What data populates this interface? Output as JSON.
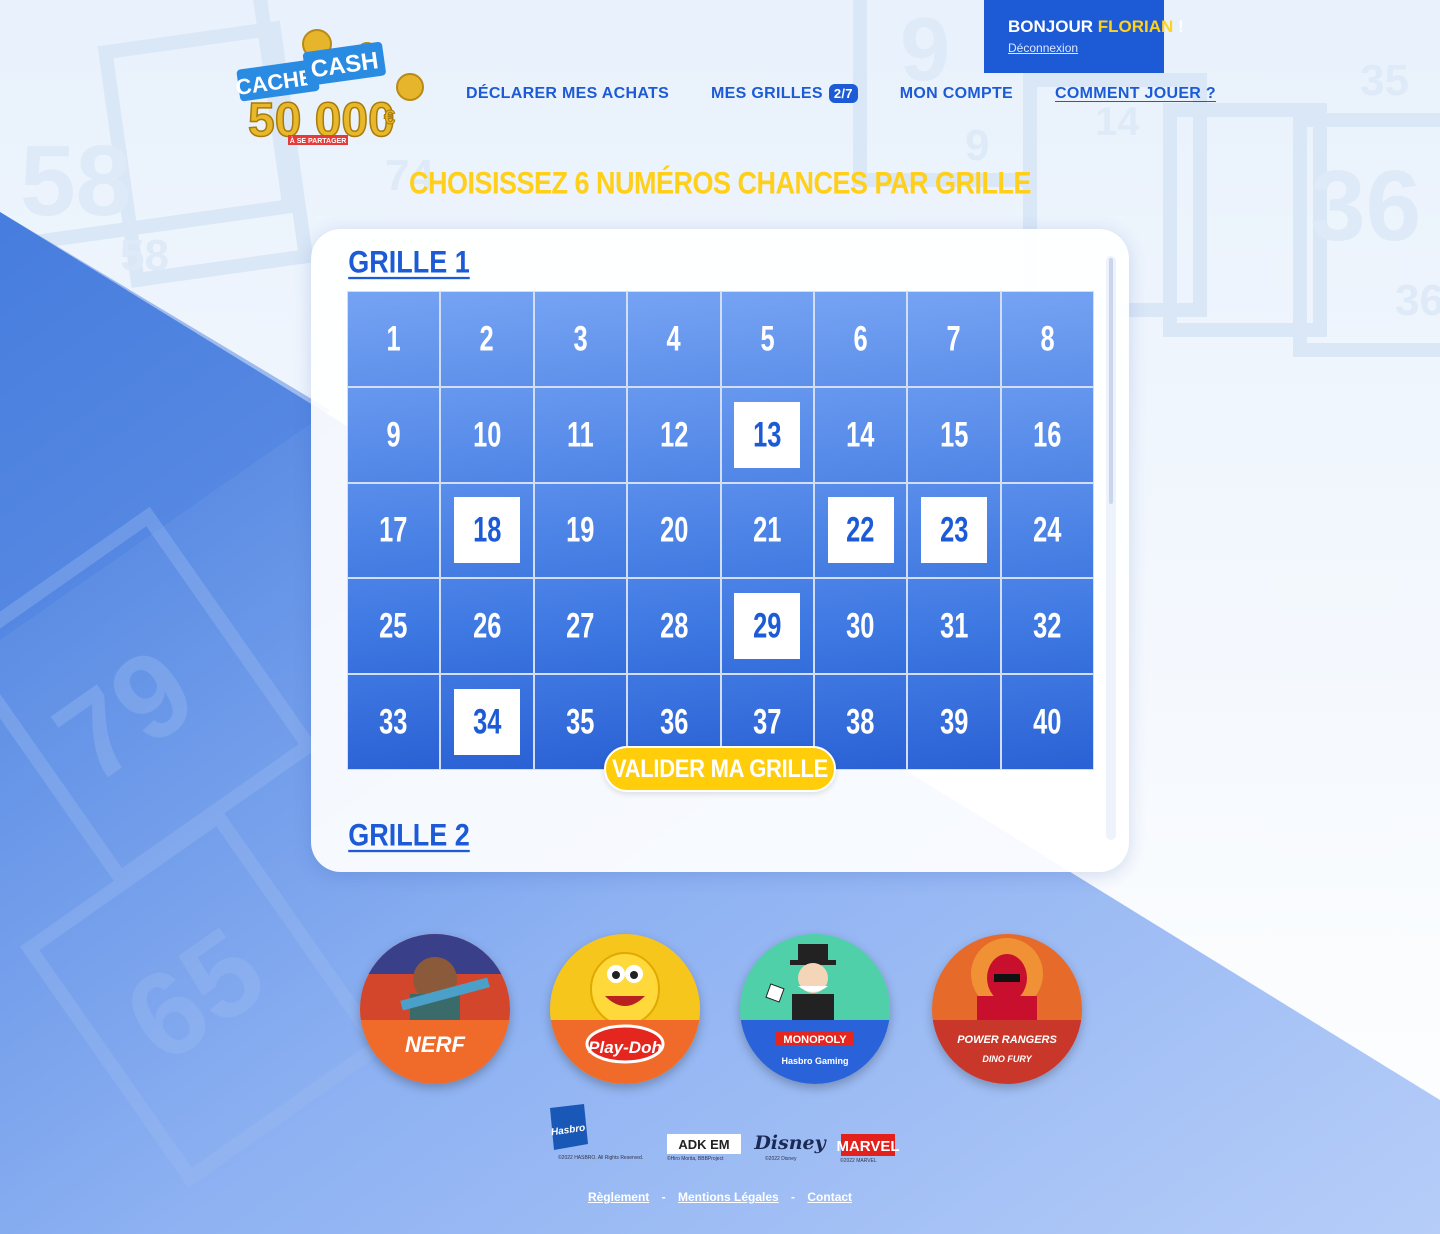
{
  "header": {
    "greeting_prefix": "BONJOUR",
    "user_name": "FLORIAN",
    "greeting_suffix": "!",
    "logout_label": "Déconnexion",
    "logo": {
      "line1": "CACHE-",
      "line2": "CASH",
      "amount": "50 000",
      "currency": "€",
      "tagline": "À SE PARTAGER"
    }
  },
  "nav": {
    "declare_label": "DÉCLARER MES ACHATS",
    "grids_label": "MES GRILLES",
    "grids_badge": "2/7",
    "account_label": "MON COMPTE",
    "howto_label": "COMMENT JOUER ?"
  },
  "headline": "CHOISISSEZ 6 NUMÉROS CHANCES PAR GRILLE",
  "grids": [
    {
      "title": "GRILLE 1",
      "numbers": [
        1,
        2,
        3,
        4,
        5,
        6,
        7,
        8,
        9,
        10,
        11,
        12,
        13,
        14,
        15,
        16,
        17,
        18,
        19,
        20,
        21,
        22,
        23,
        24,
        25,
        26,
        27,
        28,
        29,
        30,
        31,
        32,
        33,
        34,
        35,
        36,
        37,
        38,
        39,
        40
      ],
      "selected": [
        13,
        18,
        22,
        23,
        29,
        34
      ]
    },
    {
      "title": "GRILLE 2"
    }
  ],
  "validate_label": "VALIDER MA GRILLE",
  "brands": [
    {
      "name": "NERF"
    },
    {
      "name": "Play-Doh"
    },
    {
      "name": "MONOPOLY",
      "sub": "Hasbro Gaming"
    },
    {
      "name": "POWER RANGERS",
      "sub": "DINO FURY"
    }
  ],
  "partners": [
    {
      "name": "Hasbro",
      "caption": "©2022 HASBRO. All Rights Reserved."
    },
    {
      "name": "ADK EM",
      "caption": "©Hiro Morita, BBBProject"
    },
    {
      "name": "Disney",
      "caption": "©2022 Disney"
    },
    {
      "name": "MARVEL",
      "caption": "©2022 MARVEL"
    }
  ],
  "footer": {
    "rules_label": "Règlement",
    "legal_label": "Mentions Légales",
    "contact_label": "Contact",
    "separator": "-"
  },
  "colors": {
    "primary_blue": "#1d5bd6",
    "accent_yellow": "#ffcf1a",
    "cell_blue": "#5b8ff0"
  }
}
